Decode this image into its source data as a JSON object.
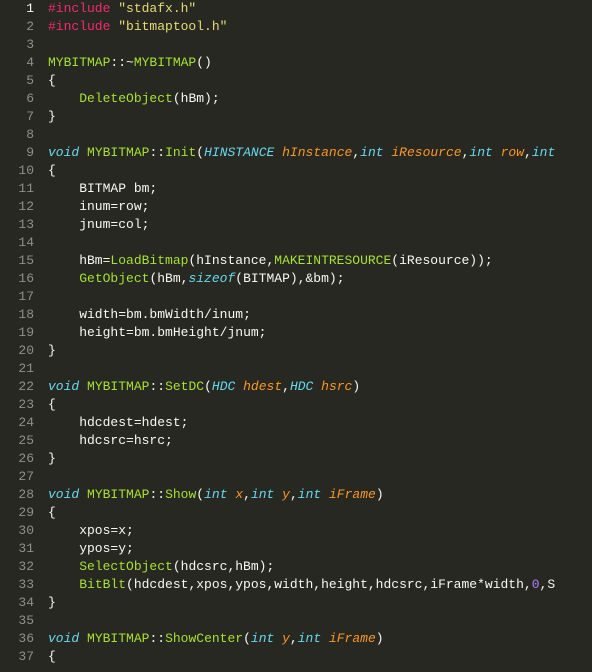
{
  "editor": {
    "lang": "cpp",
    "current_line": 1,
    "line_count": 37,
    "lines": [
      {
        "n": 1,
        "tokens": [
          {
            "c": "t-preproc",
            "t": "#include "
          },
          {
            "c": "t-string",
            "t": "\"stdafx.h\""
          }
        ]
      },
      {
        "n": 2,
        "tokens": [
          {
            "c": "t-preproc",
            "t": "#include "
          },
          {
            "c": "t-string",
            "t": "\"bitmaptool.h\""
          }
        ]
      },
      {
        "n": 3,
        "tokens": []
      },
      {
        "n": 4,
        "tokens": [
          {
            "c": "t-class",
            "t": "MYBITMAP"
          },
          {
            "c": "t-punct",
            "t": "::~"
          },
          {
            "c": "t-func",
            "t": "MYBITMAP"
          },
          {
            "c": "t-punct",
            "t": "()"
          }
        ]
      },
      {
        "n": 5,
        "tokens": [
          {
            "c": "t-punct",
            "t": "{"
          }
        ]
      },
      {
        "n": 6,
        "tokens": [
          {
            "c": "t-plain",
            "t": "    "
          },
          {
            "c": "t-func",
            "t": "DeleteObject"
          },
          {
            "c": "t-punct",
            "t": "(hBm);"
          }
        ]
      },
      {
        "n": 7,
        "tokens": [
          {
            "c": "t-punct",
            "t": "}"
          }
        ]
      },
      {
        "n": 8,
        "tokens": []
      },
      {
        "n": 9,
        "tokens": [
          {
            "c": "t-type",
            "t": "void"
          },
          {
            "c": "t-plain",
            "t": " "
          },
          {
            "c": "t-class",
            "t": "MYBITMAP"
          },
          {
            "c": "t-punct",
            "t": "::"
          },
          {
            "c": "t-func",
            "t": "Init"
          },
          {
            "c": "t-punct",
            "t": "("
          },
          {
            "c": "t-type",
            "t": "HINSTANCE"
          },
          {
            "c": "t-plain",
            "t": " "
          },
          {
            "c": "t-param",
            "t": "hInstance"
          },
          {
            "c": "t-punct",
            "t": ","
          },
          {
            "c": "t-type",
            "t": "int"
          },
          {
            "c": "t-plain",
            "t": " "
          },
          {
            "c": "t-param",
            "t": "iResource"
          },
          {
            "c": "t-punct",
            "t": ","
          },
          {
            "c": "t-type",
            "t": "int"
          },
          {
            "c": "t-plain",
            "t": " "
          },
          {
            "c": "t-param",
            "t": "row"
          },
          {
            "c": "t-punct",
            "t": ","
          },
          {
            "c": "t-type",
            "t": "int"
          }
        ]
      },
      {
        "n": 10,
        "tokens": [
          {
            "c": "t-punct",
            "t": "{"
          }
        ]
      },
      {
        "n": 11,
        "tokens": [
          {
            "c": "t-plain",
            "t": "    BITMAP bm;"
          }
        ]
      },
      {
        "n": 12,
        "tokens": [
          {
            "c": "t-plain",
            "t": "    inum"
          },
          {
            "c": "t-punct",
            "t": "="
          },
          {
            "c": "t-plain",
            "t": "row;"
          }
        ]
      },
      {
        "n": 13,
        "tokens": [
          {
            "c": "t-plain",
            "t": "    jnum"
          },
          {
            "c": "t-punct",
            "t": "="
          },
          {
            "c": "t-plain",
            "t": "col;"
          }
        ]
      },
      {
        "n": 14,
        "tokens": []
      },
      {
        "n": 15,
        "tokens": [
          {
            "c": "t-plain",
            "t": "    hBm"
          },
          {
            "c": "t-punct",
            "t": "="
          },
          {
            "c": "t-func",
            "t": "LoadBitmap"
          },
          {
            "c": "t-punct",
            "t": "(hInstance,"
          },
          {
            "c": "t-func",
            "t": "MAKEINTRESOURCE"
          },
          {
            "c": "t-punct",
            "t": "(iResource));"
          }
        ]
      },
      {
        "n": 16,
        "tokens": [
          {
            "c": "t-plain",
            "t": "    "
          },
          {
            "c": "t-func",
            "t": "GetObject"
          },
          {
            "c": "t-punct",
            "t": "(hBm,"
          },
          {
            "c": "t-keyword",
            "t": "sizeof"
          },
          {
            "c": "t-punct",
            "t": "(BITMAP),"
          },
          {
            "c": "t-punct",
            "t": "&"
          },
          {
            "c": "t-plain",
            "t": "bm);"
          }
        ]
      },
      {
        "n": 17,
        "tokens": []
      },
      {
        "n": 18,
        "tokens": [
          {
            "c": "t-plain",
            "t": "    width"
          },
          {
            "c": "t-punct",
            "t": "="
          },
          {
            "c": "t-plain",
            "t": "bm.bmWidth"
          },
          {
            "c": "t-punct",
            "t": "/"
          },
          {
            "c": "t-plain",
            "t": "inum;"
          }
        ]
      },
      {
        "n": 19,
        "tokens": [
          {
            "c": "t-plain",
            "t": "    height"
          },
          {
            "c": "t-punct",
            "t": "="
          },
          {
            "c": "t-plain",
            "t": "bm.bmHeight"
          },
          {
            "c": "t-punct",
            "t": "/"
          },
          {
            "c": "t-plain",
            "t": "jnum;"
          }
        ]
      },
      {
        "n": 20,
        "tokens": [
          {
            "c": "t-punct",
            "t": "}"
          }
        ]
      },
      {
        "n": 21,
        "tokens": []
      },
      {
        "n": 22,
        "tokens": [
          {
            "c": "t-type",
            "t": "void"
          },
          {
            "c": "t-plain",
            "t": " "
          },
          {
            "c": "t-class",
            "t": "MYBITMAP"
          },
          {
            "c": "t-punct",
            "t": "::"
          },
          {
            "c": "t-func",
            "t": "SetDC"
          },
          {
            "c": "t-punct",
            "t": "("
          },
          {
            "c": "t-type",
            "t": "HDC"
          },
          {
            "c": "t-plain",
            "t": " "
          },
          {
            "c": "t-param",
            "t": "hdest"
          },
          {
            "c": "t-punct",
            "t": ","
          },
          {
            "c": "t-type",
            "t": "HDC"
          },
          {
            "c": "t-plain",
            "t": " "
          },
          {
            "c": "t-param",
            "t": "hsrc"
          },
          {
            "c": "t-punct",
            "t": ")"
          }
        ]
      },
      {
        "n": 23,
        "tokens": [
          {
            "c": "t-punct",
            "t": "{"
          }
        ]
      },
      {
        "n": 24,
        "tokens": [
          {
            "c": "t-plain",
            "t": "    hdcdest"
          },
          {
            "c": "t-punct",
            "t": "="
          },
          {
            "c": "t-plain",
            "t": "hdest;"
          }
        ]
      },
      {
        "n": 25,
        "tokens": [
          {
            "c": "t-plain",
            "t": "    hdcsrc"
          },
          {
            "c": "t-punct",
            "t": "="
          },
          {
            "c": "t-plain",
            "t": "hsrc;"
          }
        ]
      },
      {
        "n": 26,
        "tokens": [
          {
            "c": "t-punct",
            "t": "}"
          }
        ]
      },
      {
        "n": 27,
        "tokens": []
      },
      {
        "n": 28,
        "tokens": [
          {
            "c": "t-type",
            "t": "void"
          },
          {
            "c": "t-plain",
            "t": " "
          },
          {
            "c": "t-class",
            "t": "MYBITMAP"
          },
          {
            "c": "t-punct",
            "t": "::"
          },
          {
            "c": "t-func",
            "t": "Show"
          },
          {
            "c": "t-punct",
            "t": "("
          },
          {
            "c": "t-type",
            "t": "int"
          },
          {
            "c": "t-plain",
            "t": " "
          },
          {
            "c": "t-param",
            "t": "x"
          },
          {
            "c": "t-punct",
            "t": ","
          },
          {
            "c": "t-type",
            "t": "int"
          },
          {
            "c": "t-plain",
            "t": " "
          },
          {
            "c": "t-param",
            "t": "y"
          },
          {
            "c": "t-punct",
            "t": ","
          },
          {
            "c": "t-type",
            "t": "int"
          },
          {
            "c": "t-plain",
            "t": " "
          },
          {
            "c": "t-param",
            "t": "iFrame"
          },
          {
            "c": "t-punct",
            "t": ")"
          }
        ]
      },
      {
        "n": 29,
        "tokens": [
          {
            "c": "t-punct",
            "t": "{"
          }
        ]
      },
      {
        "n": 30,
        "tokens": [
          {
            "c": "t-plain",
            "t": "    xpos"
          },
          {
            "c": "t-punct",
            "t": "="
          },
          {
            "c": "t-plain",
            "t": "x;"
          }
        ]
      },
      {
        "n": 31,
        "tokens": [
          {
            "c": "t-plain",
            "t": "    ypos"
          },
          {
            "c": "t-punct",
            "t": "="
          },
          {
            "c": "t-plain",
            "t": "y;"
          }
        ]
      },
      {
        "n": 32,
        "tokens": [
          {
            "c": "t-plain",
            "t": "    "
          },
          {
            "c": "t-func",
            "t": "SelectObject"
          },
          {
            "c": "t-punct",
            "t": "(hdcsrc,hBm);"
          }
        ]
      },
      {
        "n": 33,
        "tokens": [
          {
            "c": "t-plain",
            "t": "    "
          },
          {
            "c": "t-func",
            "t": "BitBlt"
          },
          {
            "c": "t-punct",
            "t": "(hdcdest,xpos,ypos,width,height,hdcsrc,iFrame"
          },
          {
            "c": "t-punct",
            "t": "*"
          },
          {
            "c": "t-plain",
            "t": "width,"
          },
          {
            "c": "t-num",
            "t": "0"
          },
          {
            "c": "t-punct",
            "t": ",S"
          }
        ]
      },
      {
        "n": 34,
        "tokens": [
          {
            "c": "t-punct",
            "t": "}"
          }
        ]
      },
      {
        "n": 35,
        "tokens": []
      },
      {
        "n": 36,
        "tokens": [
          {
            "c": "t-type",
            "t": "void"
          },
          {
            "c": "t-plain",
            "t": " "
          },
          {
            "c": "t-class",
            "t": "MYBITMAP"
          },
          {
            "c": "t-punct",
            "t": "::"
          },
          {
            "c": "t-func",
            "t": "ShowCenter"
          },
          {
            "c": "t-punct",
            "t": "("
          },
          {
            "c": "t-type",
            "t": "int"
          },
          {
            "c": "t-plain",
            "t": " "
          },
          {
            "c": "t-param",
            "t": "y"
          },
          {
            "c": "t-punct",
            "t": ","
          },
          {
            "c": "t-type",
            "t": "int"
          },
          {
            "c": "t-plain",
            "t": " "
          },
          {
            "c": "t-param",
            "t": "iFrame"
          },
          {
            "c": "t-punct",
            "t": ")"
          }
        ]
      },
      {
        "n": 37,
        "tokens": [
          {
            "c": "t-punct",
            "t": "{"
          }
        ]
      }
    ]
  }
}
